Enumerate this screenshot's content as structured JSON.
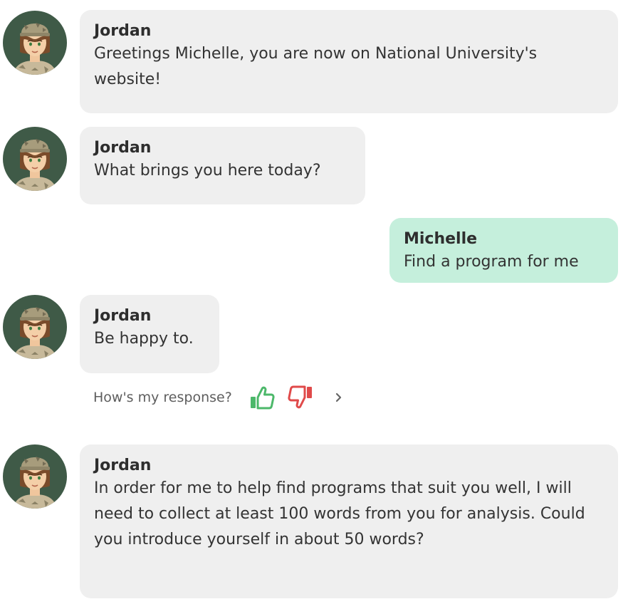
{
  "conversation": {
    "messages": [
      {
        "sender": "Jordan",
        "role": "bot",
        "text": "Greetings Michelle, you are now on National University's website!"
      },
      {
        "sender": "Jordan",
        "role": "bot",
        "text": "What brings you here today?"
      },
      {
        "sender": "Michelle",
        "role": "user",
        "text": "Find a program for me"
      },
      {
        "sender": "Jordan",
        "role": "bot",
        "text": "Be happy to."
      },
      {
        "sender": "Jordan",
        "role": "bot",
        "text": "In order for me to help find programs that suit you well, I will need to collect at least 100 words from you for analysis. Could you introduce yourself in about 50 words?"
      }
    ]
  },
  "feedback": {
    "prompt": "How's my response?",
    "thumbs_up_icon": "thumbs-up-icon",
    "thumbs_down_icon": "thumbs-down-icon",
    "more_icon": "chevron-right-icon"
  },
  "colors": {
    "bot_bubble": "#efefef",
    "user_bubble": "#c5efdc",
    "avatar_background": "#3f5a47",
    "thumbs_up": "#4cb86a",
    "thumbs_down": "#e04a4a"
  }
}
